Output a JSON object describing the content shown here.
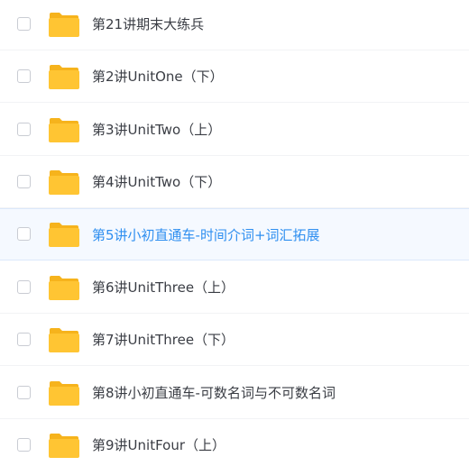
{
  "file_list": {
    "items": [
      {
        "name": "第21讲期末大练兵",
        "icon": "folder-icon",
        "hovered": false
      },
      {
        "name": "第2讲UnitOne（下）",
        "icon": "folder-icon",
        "hovered": false
      },
      {
        "name": "第3讲UnitTwo（上）",
        "icon": "folder-icon",
        "hovered": false
      },
      {
        "name": "第4讲UnitTwo（下）",
        "icon": "folder-icon",
        "hovered": false
      },
      {
        "name": "第5讲小初直通车-时间介词+词汇拓展",
        "icon": "folder-icon",
        "hovered": true
      },
      {
        "name": "第6讲UnitThree（上）",
        "icon": "folder-icon",
        "hovered": false
      },
      {
        "name": "第7讲UnitThree（下）",
        "icon": "folder-icon",
        "hovered": false
      },
      {
        "name": "第8讲小初直通车-可数名词与不可数名词",
        "icon": "folder-icon",
        "hovered": false
      },
      {
        "name": "第9讲UnitFour（上）",
        "icon": "folder-icon",
        "hovered": false
      }
    ]
  },
  "colors": {
    "folder_body": "#ffc533",
    "folder_tab": "#f6b31c",
    "hover_text": "#2f8ff0",
    "text": "#3a3d44"
  }
}
